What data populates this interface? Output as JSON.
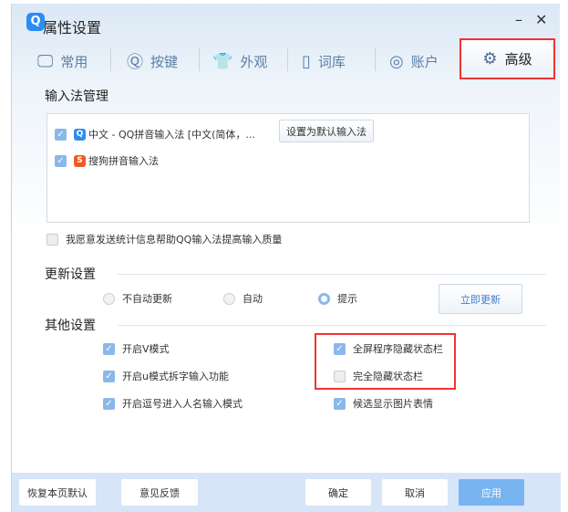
{
  "window": {
    "title": "属性设置",
    "logo": "Q",
    "minimize": "–",
    "close": "✕"
  },
  "tabs": [
    {
      "label": "常用",
      "icon": "monitor-icon",
      "glyph": "🖵"
    },
    {
      "label": "按键",
      "icon": "key-icon",
      "glyph": "Ⓠ"
    },
    {
      "label": "外观",
      "icon": "tshirt-icon",
      "glyph": "👕"
    },
    {
      "label": "词库",
      "icon": "book-icon",
      "glyph": "▯"
    },
    {
      "label": "账户",
      "icon": "user-icon",
      "glyph": "◎"
    },
    {
      "label": "高级",
      "icon": "gear-icon",
      "glyph": "⚙"
    }
  ],
  "ime": {
    "heading": "输入法管理",
    "items": [
      {
        "label": "中文 - QQ拼音输入法 [中文(简体，...",
        "icon": "Q",
        "checked": true
      },
      {
        "label": "搜狗拼音输入法",
        "icon": "S",
        "checked": true
      }
    ],
    "set_default": "设置为默认输入法",
    "stats_label": "我愿意发送统计信息帮助QQ输入法提高输入质量",
    "stats_checked": false
  },
  "update": {
    "heading": "更新设置",
    "options": [
      "不自动更新",
      "自动",
      "提示"
    ],
    "selected": "提示",
    "update_now": "立即更新"
  },
  "other": {
    "heading": "其他设置",
    "left": [
      {
        "label": "开启V模式",
        "checked": true
      },
      {
        "label": "开启u模式拆字输入功能",
        "checked": true
      },
      {
        "label": "开启逗号进入人名输入模式",
        "checked": true
      }
    ],
    "right": [
      {
        "label": "全屏程序隐藏状态栏",
        "checked": true
      },
      {
        "label": "完全隐藏状态栏",
        "checked": false
      },
      {
        "label": "候选显示图片表情",
        "checked": true
      }
    ]
  },
  "footer": {
    "restore": "恢复本页默认",
    "feedback": "意见反馈",
    "ok": "确定",
    "cancel": "取消",
    "apply": "应用"
  },
  "colors": {
    "accent": "#8bb8ea",
    "highlight": "#e33333",
    "apply": "#78b4f0"
  }
}
